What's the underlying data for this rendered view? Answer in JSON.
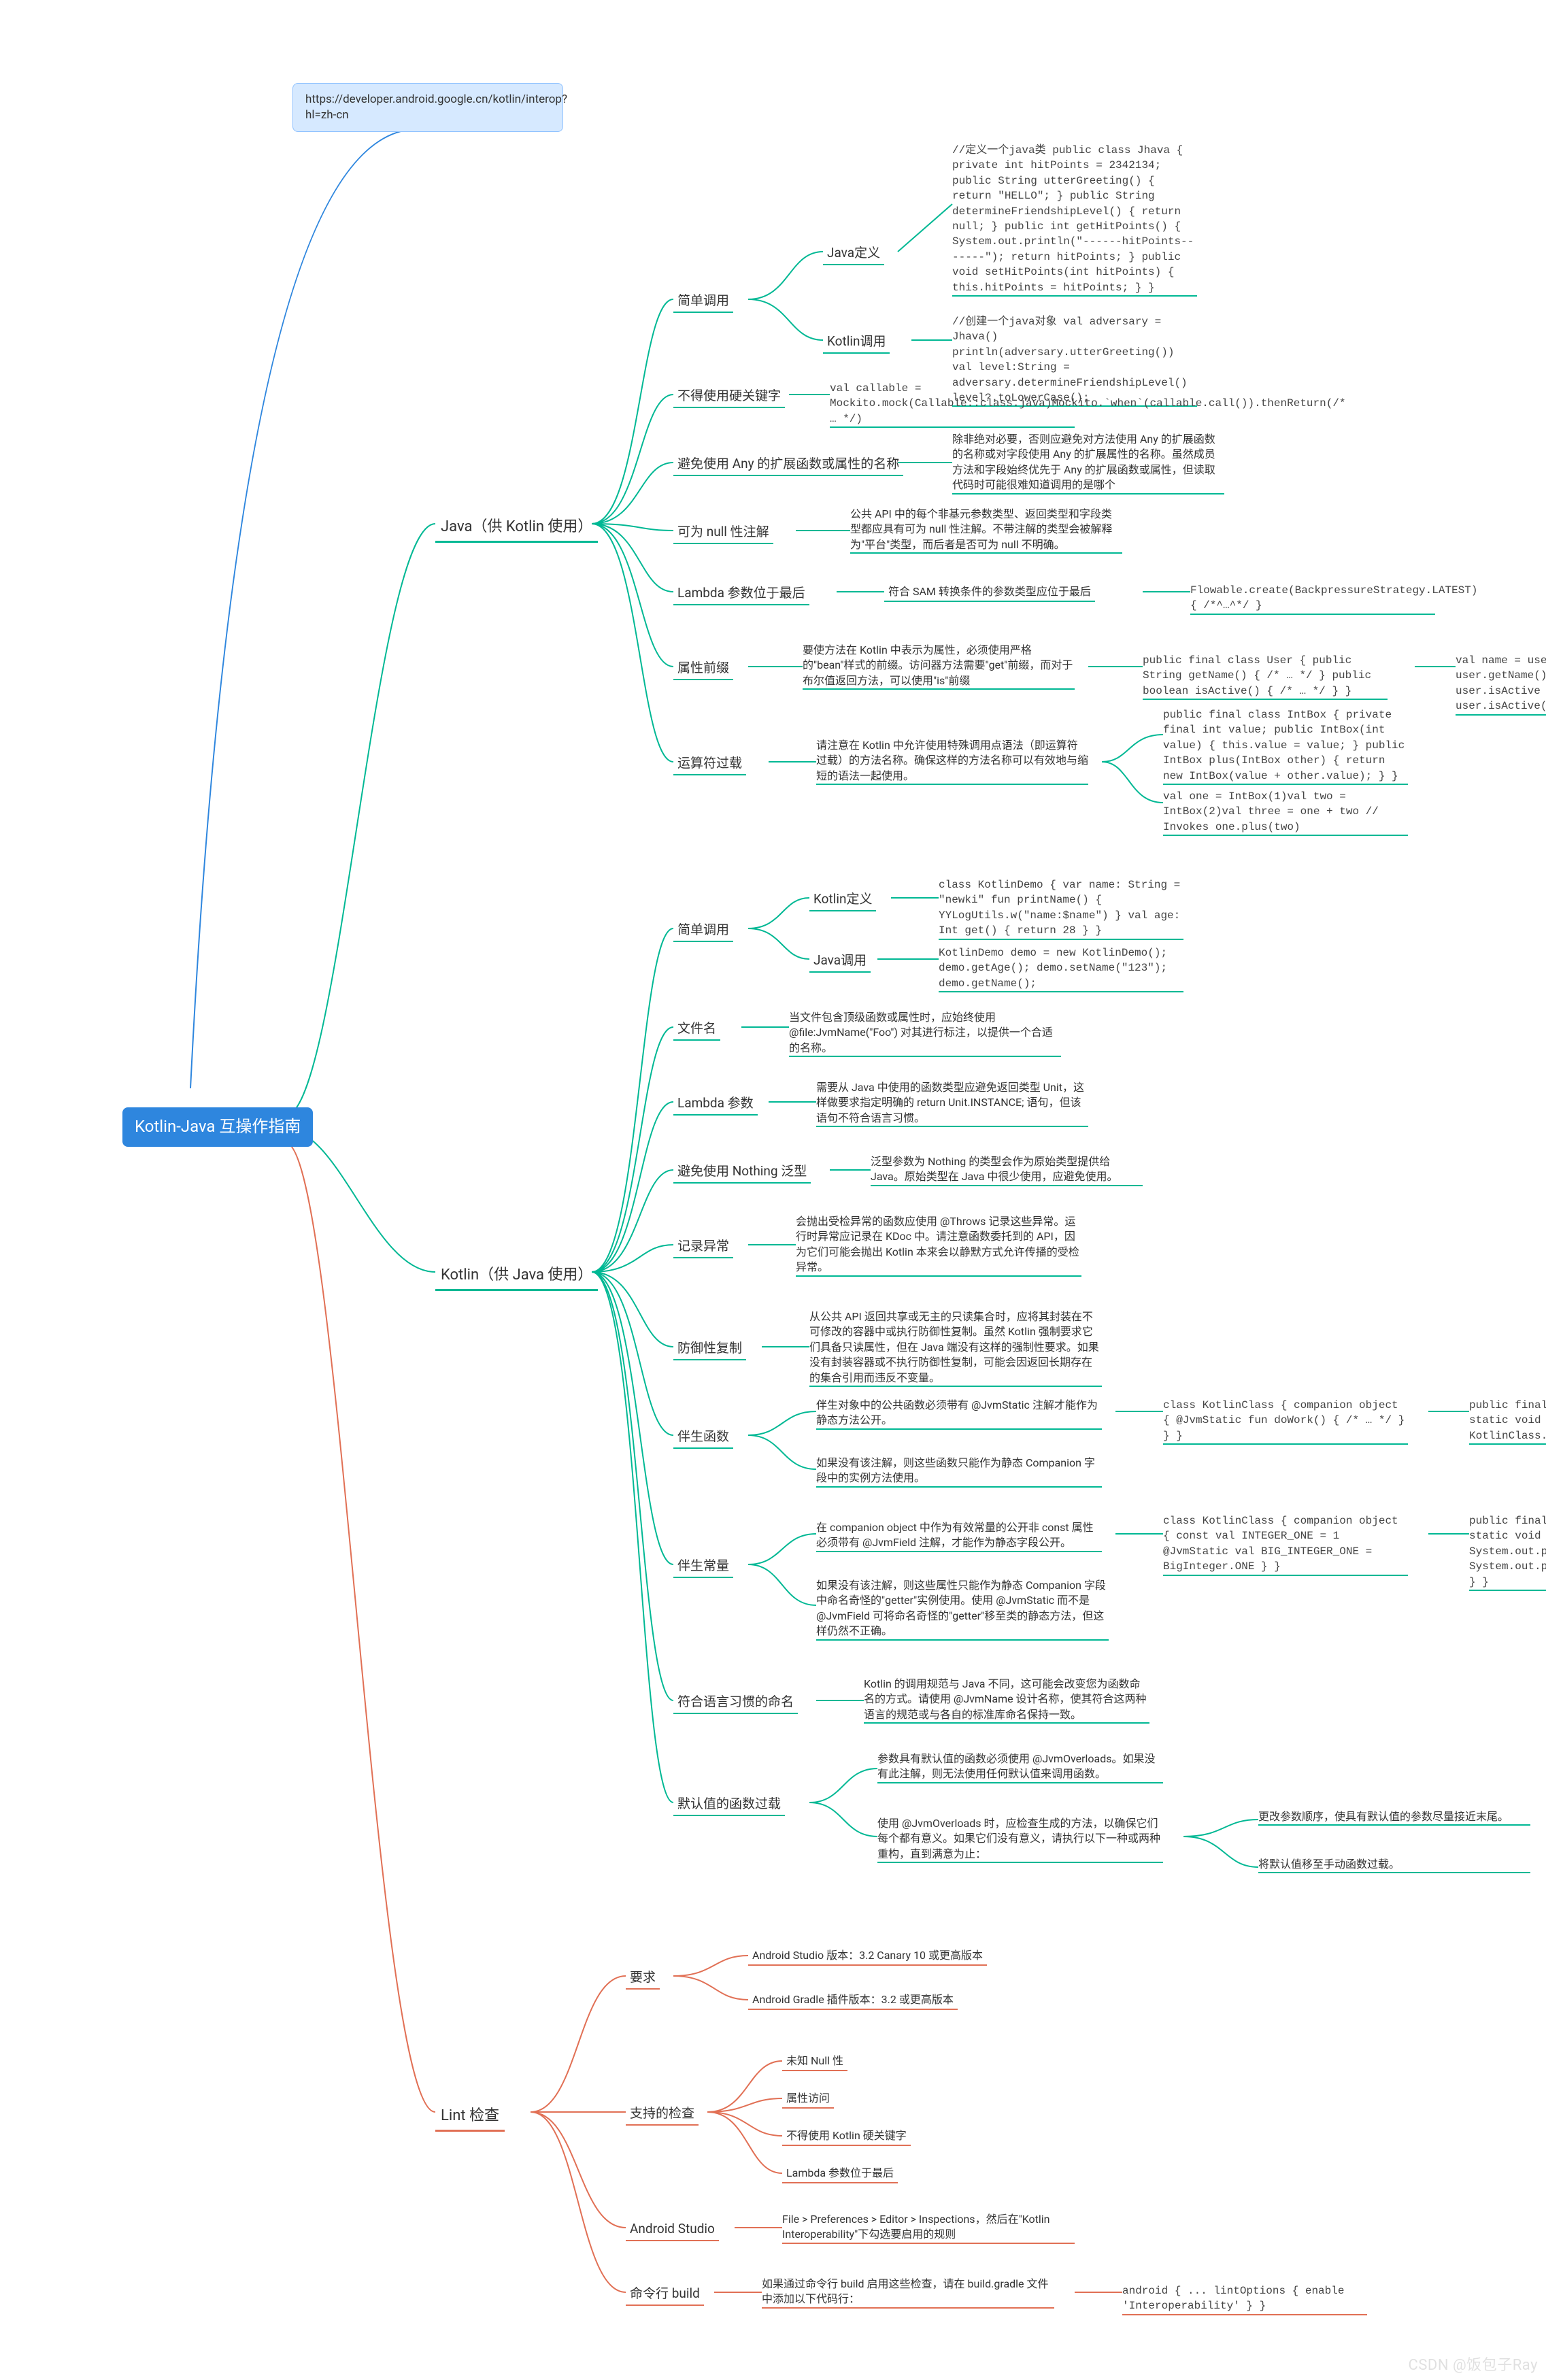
{
  "root": {
    "link_box": "https://developer.android.google.cn/kotlin/interop?hl=zh-cn",
    "title": "Kotlin-Java 互操作指南"
  },
  "branches": {
    "java": {
      "title": "Java（供 Kotlin 使用）",
      "items": {
        "simple": {
          "label": "简单调用",
          "java_def": "Java定义",
          "java_def_code": "//定义一个java类 public class Jhava { private int hitPoints = 2342134; public String utterGreeting() { return \"HELLO\"; } public String determineFriendshipLevel() { return null; } public int getHitPoints() { System.out.println(\"------hitPoints-------\"); return hitPoints; } public void setHitPoints(int hitPoints) { this.hitPoints = hitPoints; } }",
          "kotlin_call": "Kotlin调用",
          "kotlin_call_code": "//创建一个java对象 val adversary = Jhava() println(adversary.utterGreeting()) val level:String = adversary.determineFriendshipLevel() level?.toLowerCase();"
        },
        "hard_keyword": {
          "label": "不得使用硬关键字",
          "code": "val callable = Mockito.mock(Callable::class.java)Mockito.`when`(callable.call()).thenReturn(/* … */)"
        },
        "avoid_any": {
          "label": "避免使用 Any 的扩展函数或属性的名称",
          "desc": "除非绝对必要，否则应避免对方法使用 Any 的扩展函数的名称或对字段使用 Any 的扩展属性的名称。虽然成员方法和字段始终优先于 Any 的扩展函数或属性，但读取代码时可能很难知道调用的是哪个"
        },
        "null_anno": {
          "label": "可为 null 性注解",
          "desc": "公共 API 中的每个非基元参数类型、返回类型和字段类型都应具有可为 null 性注解。不带注解的类型会被解释为\"平台\"类型，而后者是否可为 null 不明确。"
        },
        "lambda_last": {
          "label": "Lambda 参数位于最后",
          "desc": "符合 SAM 转换条件的参数类型应位于最后",
          "code": "Flowable.create(BackpressureStrategy.LATEST) { /*^…^*/ }"
        },
        "prop_prefix": {
          "label": "属性前缀",
          "desc": "要使方法在 Kotlin 中表示为属性，必须使用严格的\"bean\"样式的前缀。访问器方法需要\"get\"前缀，而对于布尔值返回方法，可以使用\"is\"前缀",
          "code": "public final class User { public String getName() { /* … */ } public boolean isActive() { /* … */ } }",
          "code2": "val name = user.name // Invokes user.getName()val active = user.isActive // Invokes user.isActive()"
        },
        "op_overload": {
          "label": "运算符过载",
          "desc": "请注意在 Kotlin 中允许使用特殊调用点语法（即运算符过载）的方法名称。确保这样的方法名称可以有效地与缩短的语法一起使用。",
          "code1": "public final class IntBox { private final int value; public IntBox(int value) { this.value = value; } public IntBox plus(IntBox other) { return new IntBox(value + other.value); } }",
          "code2": "val one = IntBox(1)val two = IntBox(2)val three = one + two // Invokes one.plus(two)"
        }
      }
    },
    "kotlin": {
      "title": "Kotlin（供 Java 使用）",
      "items": {
        "simple": {
          "label": "简单调用",
          "kotlin_def": "Kotlin定义",
          "kotlin_def_code": "class KotlinDemo { var name: String = \"newki\" fun printName() { YYLogUtils.w(\"name:$name\") } val age: Int get() { return 28 } }",
          "java_call": "Java调用",
          "java_call_code": "KotlinDemo demo = new KotlinDemo(); demo.getAge(); demo.setName(\"123\"); demo.getName();"
        },
        "file_name": {
          "label": "文件名",
          "desc": "当文件包含顶级函数或属性时，应始终使用 @file:JvmName(\"Foo\") 对其进行标注，以提供一个合适的名称。"
        },
        "lambda": {
          "label": "Lambda 参数",
          "desc": "需要从 Java 中使用的函数类型应避免返回类型 Unit，这样做要求指定明确的 return Unit.INSTANCE; 语句，但该语句不符合语言习惯。"
        },
        "nothing": {
          "label": "避免使用 Nothing 泛型",
          "desc": "泛型参数为 Nothing 的类型会作为原始类型提供给 Java。原始类型在 Java 中很少使用，应避免使用。"
        },
        "exception": {
          "label": "记录异常",
          "desc": "会抛出受检异常的函数应使用 @Throws 记录这些异常。运行时异常应记录在 KDoc 中。请注意函数委托到的 API，因为它们可能会抛出 Kotlin 本来会以静默方式允许传播的受检异常。"
        },
        "def_copy": {
          "label": "防御性复制",
          "desc": "从公共 API 返回共享或无主的只读集合时，应将其封装在不可修改的容器中或执行防御性复制。虽然 Kotlin 强制要求它们具备只读属性，但在 Java 端没有这样的强制性要求。如果没有封装容器或不执行防御性复制，可能会因返回长期存在的集合引用而违反不变量。"
        },
        "companion_fn": {
          "label": "伴生函数",
          "desc1": "伴生对象中的公共函数必须带有 @JvmStatic 注解才能作为静态方法公开。",
          "desc2": "如果没有该注解，则这些函数只能作为静态 Companion 字段中的实例方法使用。",
          "code1": "class KotlinClass { companion object { @JvmStatic fun doWork() { /* … */ } } }",
          "code2": "public final class JavaClass { public static void main(String... args) { KotlinClass.doWork(); } }"
        },
        "companion_const": {
          "label": "伴生常量",
          "desc1": "在 companion object 中作为有效常量的公开非 const 属性必须带有 @JvmField 注解，才能作为静态字段公开。",
          "desc2": "如果没有该注解，则这些属性只能作为静态 Companion 字段中命名奇怪的\"getter\"实例使用。使用 @JvmStatic 而不是 @JvmField 可将命名奇怪的\"getter\"移至类的静态方法，但这样仍然不正确。",
          "code1": "class KotlinClass { companion object { const val INTEGER_ONE = 1 @JvmStatic val BIG_INTEGER_ONE = BigInteger.ONE } }",
          "code2": "public final class JavaClass { public static void main(String... args) { System.out.println(KotlinClass.INTEGER_ONE); System.out.println(KotlinClass.BIG_INTEGER_ONE); } }"
        },
        "naming": {
          "label": "符合语言习惯的命名",
          "desc": "Kotlin 的调用规范与 Java 不同，这可能会改变您为函数命名的方式。请使用 @JvmName 设计名称，使其符合这两种语言的规范或与各自的标准库命名保持一致。"
        },
        "default_overload": {
          "label": "默认值的函数过载",
          "desc1": "参数具有默认值的函数必须使用 @JvmOverloads。如果没有此注解，则无法使用任何默认值来调用函数。",
          "desc2": "使用 @JvmOverloads 时，应检查生成的方法，以确保它们每个都有意义。如果它们没有意义，请执行以下一种或两种重构，直到满意为止：",
          "o1": "更改参数顺序，使具有默认值的参数尽量接近末尾。",
          "o2": "将默认值移至手动函数过载。"
        }
      }
    },
    "lint": {
      "title": "Lint 检查",
      "items": {
        "req": {
          "label": "要求",
          "a": "Android Studio 版本：3.2 Canary 10 或更高版本",
          "b": "Android Gradle 插件版本：3.2 或更高版本"
        },
        "checks": {
          "label": "支持的检查",
          "a": "未知 Null 性",
          "b": "属性访问",
          "c": "不得使用 Kotlin 硬关键字",
          "d": "Lambda 参数位于最后"
        },
        "as": {
          "label": "Android Studio",
          "desc": "File > Preferences > Editor > Inspections，然后在\"Kotlin Interoperability\"下勾选要启用的规则"
        },
        "cmd": {
          "label": "命令行 build",
          "desc": "如果通过命令行 build 启用这些检查，请在 build.gradle 文件中添加以下代码行：",
          "code": "android { ... lintOptions { enable 'Interoperability' } }"
        }
      }
    }
  },
  "watermark": "CSDN @饭包子Ray"
}
